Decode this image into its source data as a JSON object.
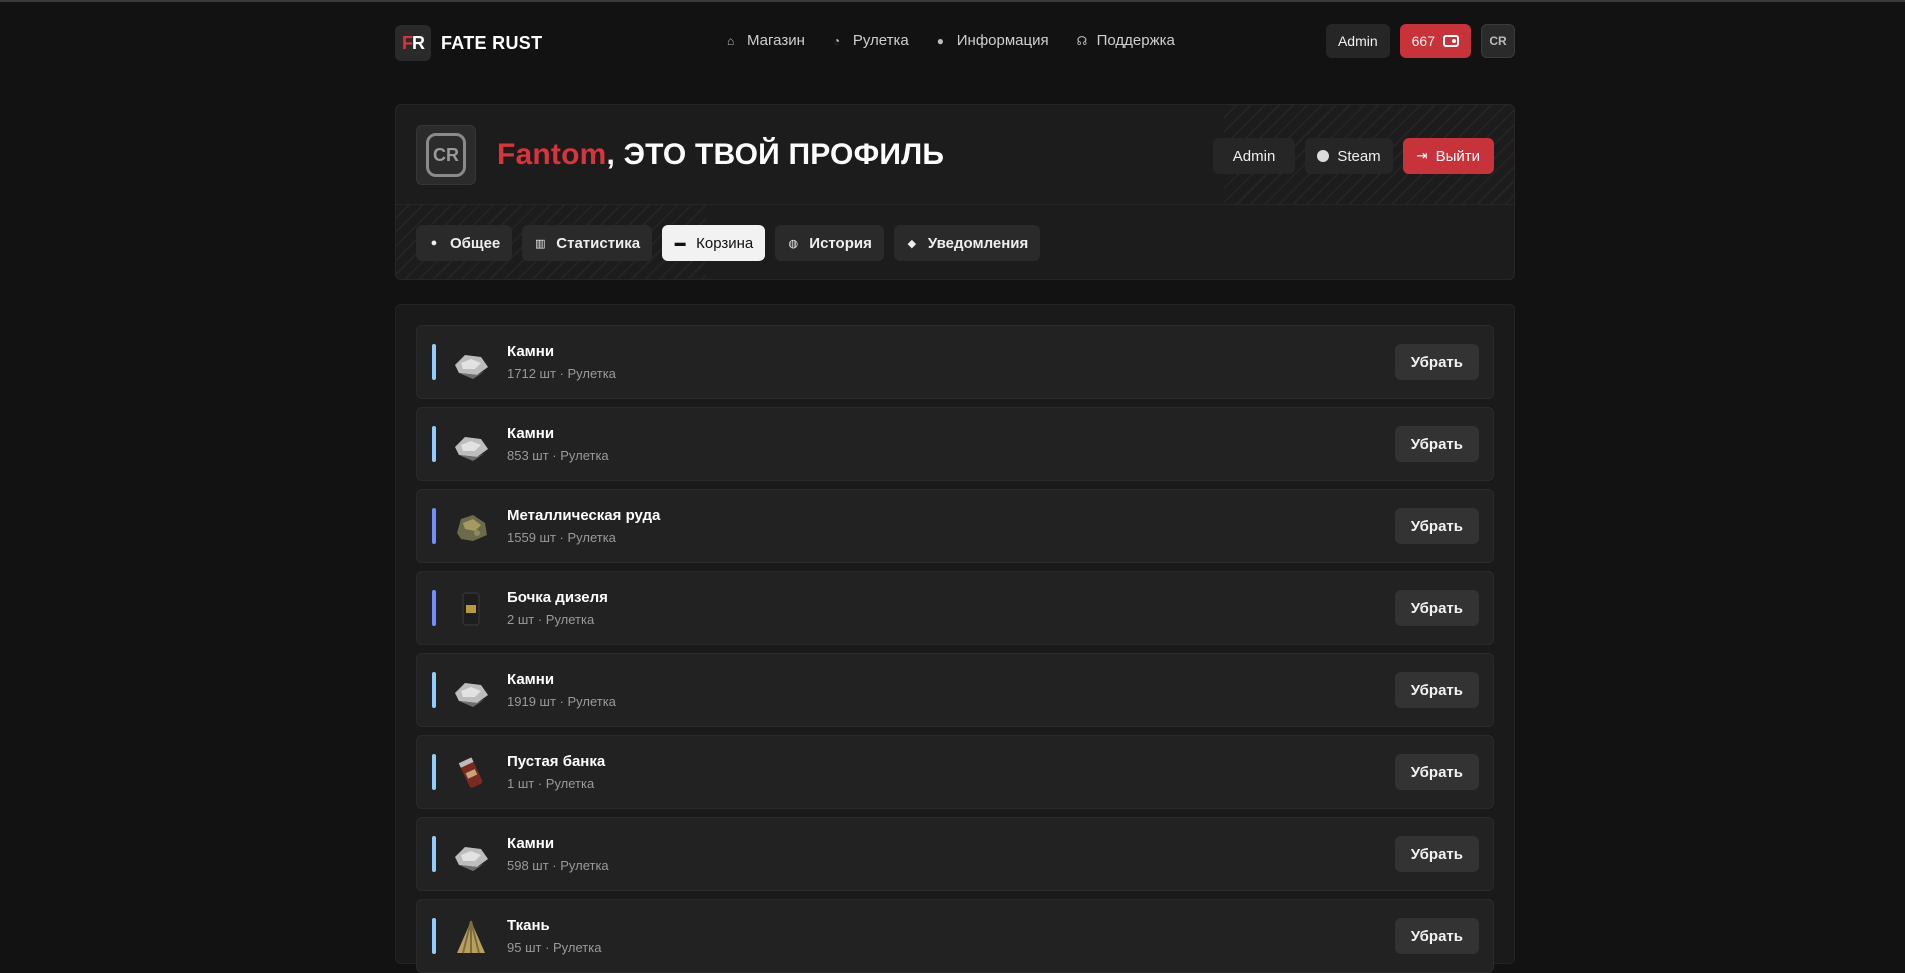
{
  "brand": {
    "mark_f": "F",
    "mark_r": "R",
    "name": "FATE RUST"
  },
  "nav": [
    {
      "label": "Магазин",
      "icon": "shop-icon"
    },
    {
      "label": "Рулетка",
      "icon": "roulette-icon"
    },
    {
      "label": "Информация",
      "icon": "info-icon"
    },
    {
      "label": "Поддержка",
      "icon": "support-icon"
    }
  ],
  "header": {
    "admin_label": "Admin",
    "balance": "667",
    "avatar_text": "CR"
  },
  "profile": {
    "avatar_text": "CR",
    "nickname": "Fantom",
    "title_rest": ", ЭТО ТВОЙ ПРОФИЛЬ",
    "actions": {
      "admin": "Admin",
      "steam": "Steam",
      "logout": "Выйти"
    },
    "tabs": [
      {
        "label": "Общее",
        "icon": "info-icon",
        "active": false
      },
      {
        "label": "Статистика",
        "icon": "stats-icon",
        "active": false
      },
      {
        "label": "Корзина",
        "icon": "cart-icon",
        "active": true
      },
      {
        "label": "История",
        "icon": "history-icon",
        "active": false
      },
      {
        "label": "Уведомления",
        "icon": "bell-icon",
        "active": false
      }
    ]
  },
  "cart": {
    "remove_label": "Убрать",
    "items": [
      {
        "name": "Камни",
        "meta": "1712 шт · Рулетка",
        "rarity_color": "#8ecfff",
        "icon": "stones-icon"
      },
      {
        "name": "Камни",
        "meta": "853 шт · Рулетка",
        "rarity_color": "#8ecfff",
        "icon": "stones-icon"
      },
      {
        "name": "Металлическая руда",
        "meta": "1559 шт · Рулетка",
        "rarity_color": "#6f8fff",
        "icon": "metal-ore-icon"
      },
      {
        "name": "Бочка дизеля",
        "meta": "2 шт · Рулетка",
        "rarity_color": "#6f8fff",
        "icon": "diesel-barrel-icon"
      },
      {
        "name": "Камни",
        "meta": "1919 шт · Рулетка",
        "rarity_color": "#8ecfff",
        "icon": "stones-icon"
      },
      {
        "name": "Пустая банка",
        "meta": "1 шт · Рулетка",
        "rarity_color": "#8ecfff",
        "icon": "empty-can-icon"
      },
      {
        "name": "Камни",
        "meta": "598 шт · Рулетка",
        "rarity_color": "#8ecfff",
        "icon": "stones-icon"
      },
      {
        "name": "Ткань",
        "meta": "95 шт · Рулетка",
        "rarity_color": "#8ecfff",
        "icon": "cloth-icon"
      }
    ]
  }
}
